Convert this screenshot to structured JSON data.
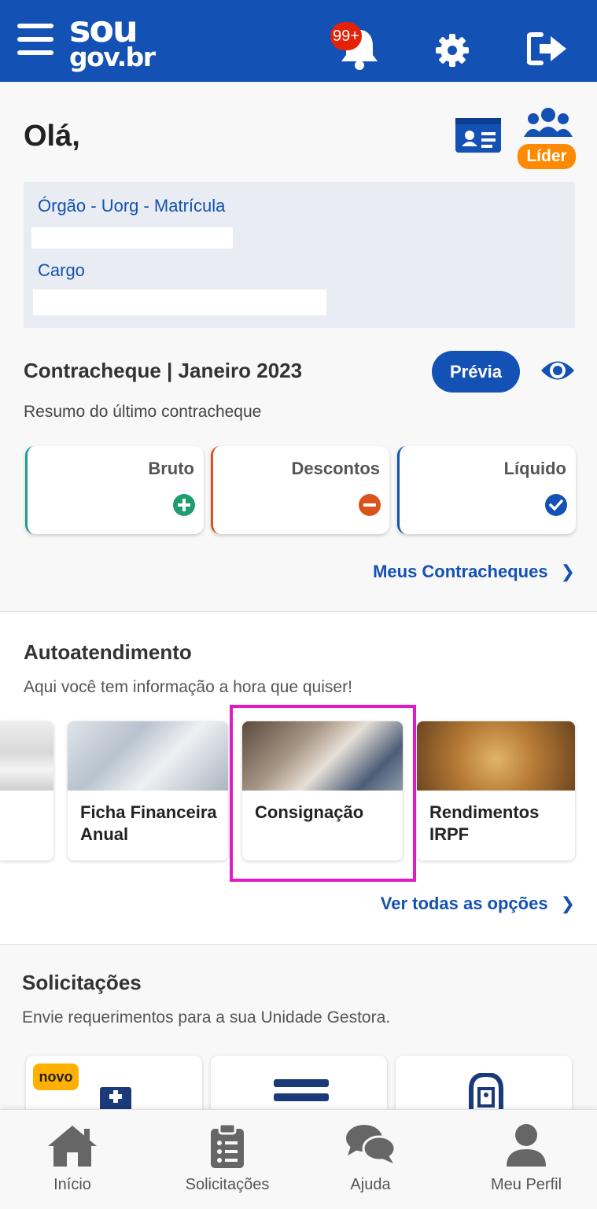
{
  "header": {
    "logo_top": "sou",
    "logo_bottom": "gov.br",
    "notification_count": "99+"
  },
  "greeting": "Olá,",
  "profile_badge": "Líder",
  "info": {
    "org_label": "Órgão - Uorg - Matrícula",
    "cargo_label": "Cargo"
  },
  "payslip": {
    "title": "Contracheque | Janeiro 2023",
    "preview_button": "Prévia",
    "subtitle": "Resumo do último contracheque",
    "cards": [
      {
        "label": "Bruto",
        "color": "#168821"
      },
      {
        "label": "Descontos",
        "color": "#d83933"
      },
      {
        "label": "Líquido",
        "color": "#1351b4"
      }
    ],
    "link": "Meus Contracheques"
  },
  "self_service": {
    "title": "Autoatendimento",
    "subtitle": "Aqui você tem informação a hora que quiser!",
    "items": [
      {
        "title_line1": "Ficha Financeira",
        "title_line2": "Anual"
      },
      {
        "title_line1": "Consignação",
        "title_line2": ""
      },
      {
        "title_line1": "Rendimentos",
        "title_line2": "IRPF"
      }
    ],
    "link": "Ver todas as opções"
  },
  "requests": {
    "title": "Solicitações",
    "subtitle": "Envie requerimentos para a sua Unidade Gestora.",
    "new_badge": "novo"
  },
  "bottom_nav": {
    "items": [
      {
        "label": "Início",
        "icon": "home-icon"
      },
      {
        "label": "Solicitações",
        "icon": "clipboard-list-icon"
      },
      {
        "label": "Ajuda",
        "icon": "chat-bubbles-icon"
      },
      {
        "label": "Meu Perfil",
        "icon": "user-icon"
      }
    ]
  },
  "colors": {
    "brand_blue": "#1351b4",
    "highlight": "#e01bc6",
    "lider_orange": "#ff8a00"
  }
}
